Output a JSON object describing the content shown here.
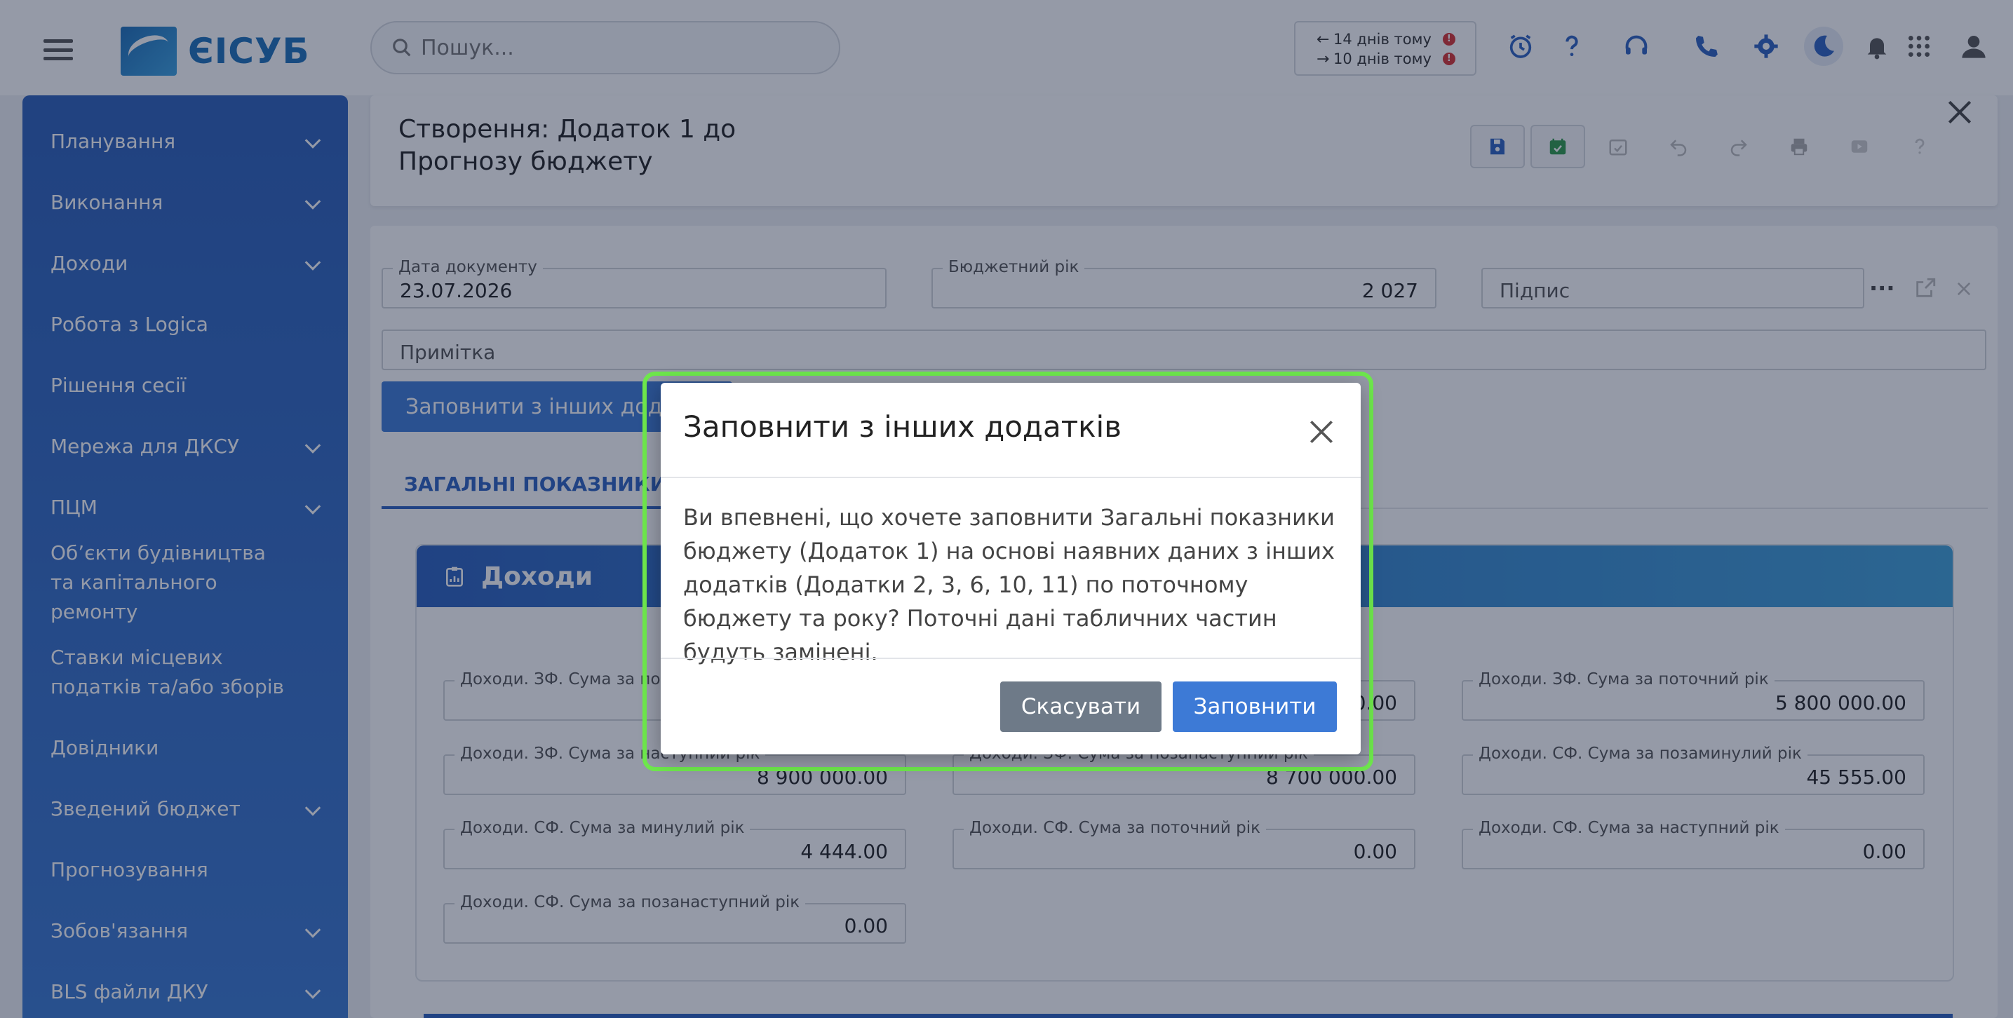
{
  "app": {
    "logo_text": "ЄІСУБ"
  },
  "search": {
    "placeholder": "Пошук..."
  },
  "history": [
    {
      "arrow": "←",
      "label": "14 днів тому",
      "badge": "!"
    },
    {
      "arrow": "→",
      "label": "10 днів тому",
      "badge": "!"
    }
  ],
  "sidebar": {
    "items": [
      {
        "label": "Планування",
        "has_chevron": true
      },
      {
        "label": "Виконання",
        "has_chevron": true
      },
      {
        "label": "Доходи",
        "has_chevron": true
      },
      {
        "label": "Робота з Logica",
        "has_chevron": false
      },
      {
        "label": "Рішення сесії",
        "has_chevron": false
      },
      {
        "label": "Мережа для ДКСУ",
        "has_chevron": true
      },
      {
        "label": "ПЦМ",
        "has_chevron": true
      },
      {
        "label": "Об’єкти будівництва та капітального ремонту",
        "has_chevron": false
      },
      {
        "label": "Ставки місцевих податків та/або зборів",
        "has_chevron": false
      },
      {
        "label": "Довідники",
        "has_chevron": false
      },
      {
        "label": "Зведений бюджет",
        "has_chevron": true
      },
      {
        "label": "Прогнозування",
        "has_chevron": false
      },
      {
        "label": "Зобов'язання",
        "has_chevron": true
      },
      {
        "label": "BLS файли ДКУ",
        "has_chevron": true
      }
    ]
  },
  "document": {
    "title": "Створення: Додаток 1 до Прогнозу бюджету",
    "date_label": "Дата документу",
    "date_value": "23.07.2026",
    "year_label": "Бюджетний рік",
    "year_value": "2 027",
    "signature_placeholder": "Підпис",
    "note_placeholder": "Примітка",
    "fill_button": "Заповнити з інших дода",
    "tab_label": "ЗАГАЛЬНІ ПОКАЗНИКИ БЮ"
  },
  "income": {
    "title": "Доходи",
    "fields": [
      {
        "label": "Доходи. ЗФ. Сума за по",
        "value": ""
      },
      {
        "label": "",
        "value": "0.00"
      },
      {
        "label": "Доходи. ЗФ. Сума за поточний рік",
        "value": "5 800 000.00"
      },
      {
        "label": "Доходи. ЗФ. Сума за наступний рік",
        "value": "8 900 000.00"
      },
      {
        "label": "Доходи. ЗФ. Сума за позанаступний рік",
        "value": "8 700 000.00"
      },
      {
        "label": "Доходи. СФ. Сума за позаминулий рік",
        "value": "45 555.00"
      },
      {
        "label": "Доходи. СФ. Сума за минулий рік",
        "value": "4 444.00"
      },
      {
        "label": "Доходи. СФ. Сума за поточний рік",
        "value": "0.00"
      },
      {
        "label": "Доходи. СФ. Сума за наступний рік",
        "value": "0.00"
      },
      {
        "label": "Доходи. СФ. Сума за позанаступний рік",
        "value": "0.00"
      }
    ]
  },
  "modal": {
    "title": "Заповнити з інших додатків",
    "body": "Ви впевнені, що хочете заповнити Загальні показники бюджету (Додаток 1) на основі наявних даних з інших додатків (Додатки 2, 3, 6, 10, 11) по поточному бюджету та року? Поточні дані табличних частин будуть замінені.",
    "cancel": "Скасувати",
    "confirm": "Заповнити"
  },
  "colors": {
    "accent": "#3d7ad6",
    "highlight": "#6ee84c",
    "sidebar": "#2c5fb8"
  }
}
